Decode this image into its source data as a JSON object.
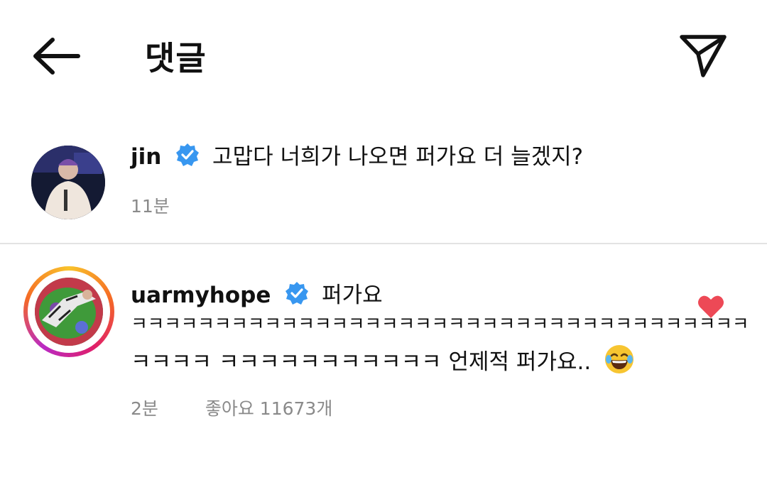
{
  "header": {
    "title": "댓글"
  },
  "comments": [
    {
      "username": "jin",
      "text": "고맙다 너희가 나오면 퍼가요 더 늘겠지?",
      "time": "11분"
    },
    {
      "username": "uarmyhope",
      "text_line1": "퍼가요",
      "text_line2": "ㅋㅋㅋㅋㅋㅋㅋㅋㅋㅋㅋㅋㅋㅋㅋㅋㅋㅋㅋㅋㅋㅋㅋㅋㅋㅋㅋㅋㅋㅋㅋㅋㅋㅋㅋㅋㅋ",
      "text_line3": "ㅋㅋㅋㅋ ㅋㅋㅋㅋㅋㅋㅋㅋㅋㅋㅋ 언제적 퍼가요..",
      "emoji": "😂",
      "time": "2분",
      "likes_label": "좋아요 11673개",
      "liked": true
    }
  ],
  "colors": {
    "verified": "#3897f0",
    "heart": "#ed4956",
    "meta": "#8a8a8a"
  },
  "icons": [
    "back-arrow-icon",
    "send-icon",
    "verified-icon",
    "heart-icon"
  ]
}
